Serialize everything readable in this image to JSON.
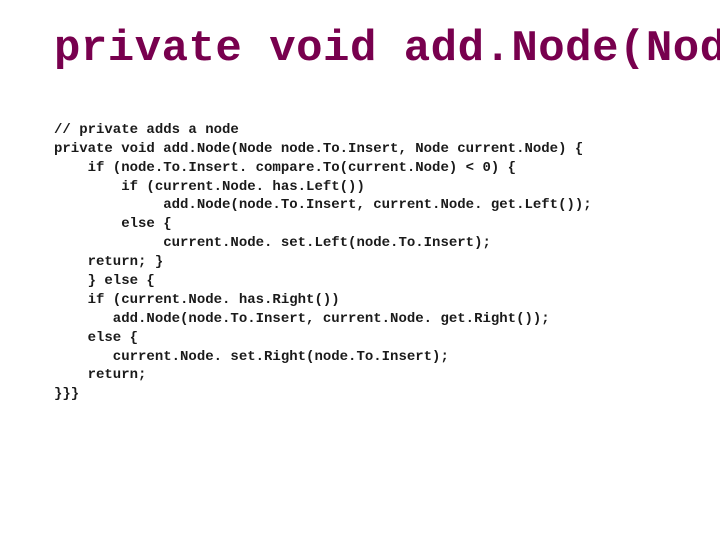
{
  "title": "private void add.Node(Node",
  "code": {
    "l1": "// private adds a node",
    "l2": "private void add.Node(Node node.To.Insert, Node current.Node) {",
    "l3": "    if (node.To.Insert. compare.To(current.Node) < 0) {",
    "l4": "        if (current.Node. has.Left())",
    "l5": "             add.Node(node.To.Insert, current.Node. get.Left());",
    "l6": "        else {",
    "l7": "             current.Node. set.Left(node.To.Insert);",
    "l8": "    return; }",
    "l9": "    } else {",
    "l10": "    if (current.Node. has.Right())",
    "l11": "       add.Node(node.To.Insert, current.Node. get.Right());",
    "l12": "    else {",
    "l13": "       current.Node. set.Right(node.To.Insert);",
    "l14": "    return;",
    "l15": "}}}"
  }
}
